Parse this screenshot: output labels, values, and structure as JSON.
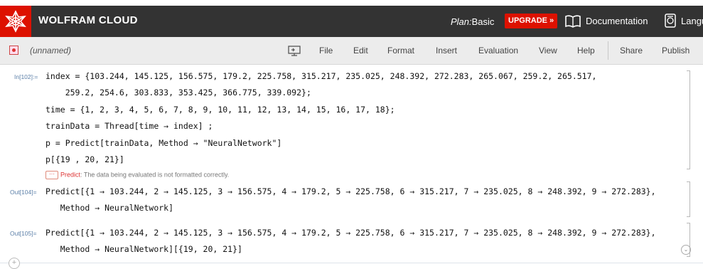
{
  "header": {
    "brand": "WOLFRAM CLOUD",
    "plan_label": "Plan:",
    "plan_value": "Basic",
    "upgrade_label": "UPGRADE »",
    "documentation_label": "Documentation",
    "language_label": "Langu",
    "accent_color": "#dd1100"
  },
  "menubar": {
    "notebook_name": "(unnamed)",
    "items": [
      "File",
      "Edit",
      "Format",
      "Insert",
      "Evaluation",
      "View",
      "Help",
      "Share",
      "Publish"
    ]
  },
  "notebook": {
    "input_label": "In[102]:=",
    "input_lines": [
      "index = {103.244, 145.125, 156.575, 179.2, 225.758, 315.217, 235.025, 248.392, 272.283, 265.067, 259.2, 265.517,",
      "    259.2, 254.6, 303.833, 353.425, 366.775, 339.092};",
      "time = {1, 2, 3, 4, 5, 6, 7, 8, 9, 10, 11, 12, 13, 14, 15, 16, 17, 18};",
      "trainData = Thread[time → index] ;",
      "p = Predict[trainData, Method → \"NeuralNetwork\"]",
      "p[{19 , 20, 21}]"
    ],
    "message_dots": "···",
    "message_tag": "Predict",
    "message_text": ": The data being evaluated is not formatted correctly.",
    "output1_label": "Out[104]=",
    "output1_lines": [
      "Predict[{1 → 103.244, 2 → 145.125, 3 → 156.575, 4 → 179.2, 5 → 225.758, 6 → 315.217, 7 → 235.025, 8 → 248.392, 9 → 272.283},",
      "   Method → NeuralNetwork]"
    ],
    "output2_label": "Out[105]=",
    "output2_lines": [
      "Predict[{1 → 103.244, 2 → 145.125, 3 → 156.575, 4 → 179.2, 5 → 225.758, 6 → 315.217, 7 → 235.025, 8 → 248.392, 9 → 272.283},",
      "   Method → NeuralNetwork][{19, 20, 21}]"
    ]
  }
}
